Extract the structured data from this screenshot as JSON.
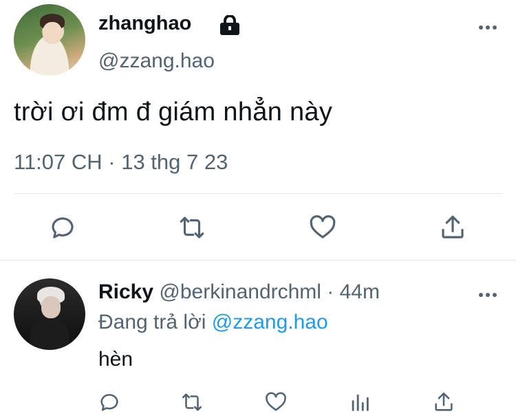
{
  "tweet": {
    "author_name": "zhanghao",
    "author_handle": "@zzang.hao",
    "protected_icon": "lock-icon",
    "text": "trời ơi đm đ giám nhẳn này",
    "timestamp": "11:07 CH · 13 thg 7 23",
    "actions": [
      "reply-icon",
      "retweet-icon",
      "like-icon",
      "share-icon"
    ]
  },
  "reply": {
    "author_name": "Ricky",
    "author_handle": "@berkinandrchml",
    "age": "· 44m",
    "replying_prefix": "Đang trả lời",
    "replying_to": "@zzang.hao",
    "text": "hèn",
    "actions": [
      "reply-icon",
      "retweet-icon",
      "like-icon",
      "analytics-icon",
      "share-icon"
    ]
  },
  "colors": {
    "text": "#0f1419",
    "secondary": "#536471",
    "link": "#1d9bf0",
    "divider": "#e1e6ea"
  }
}
